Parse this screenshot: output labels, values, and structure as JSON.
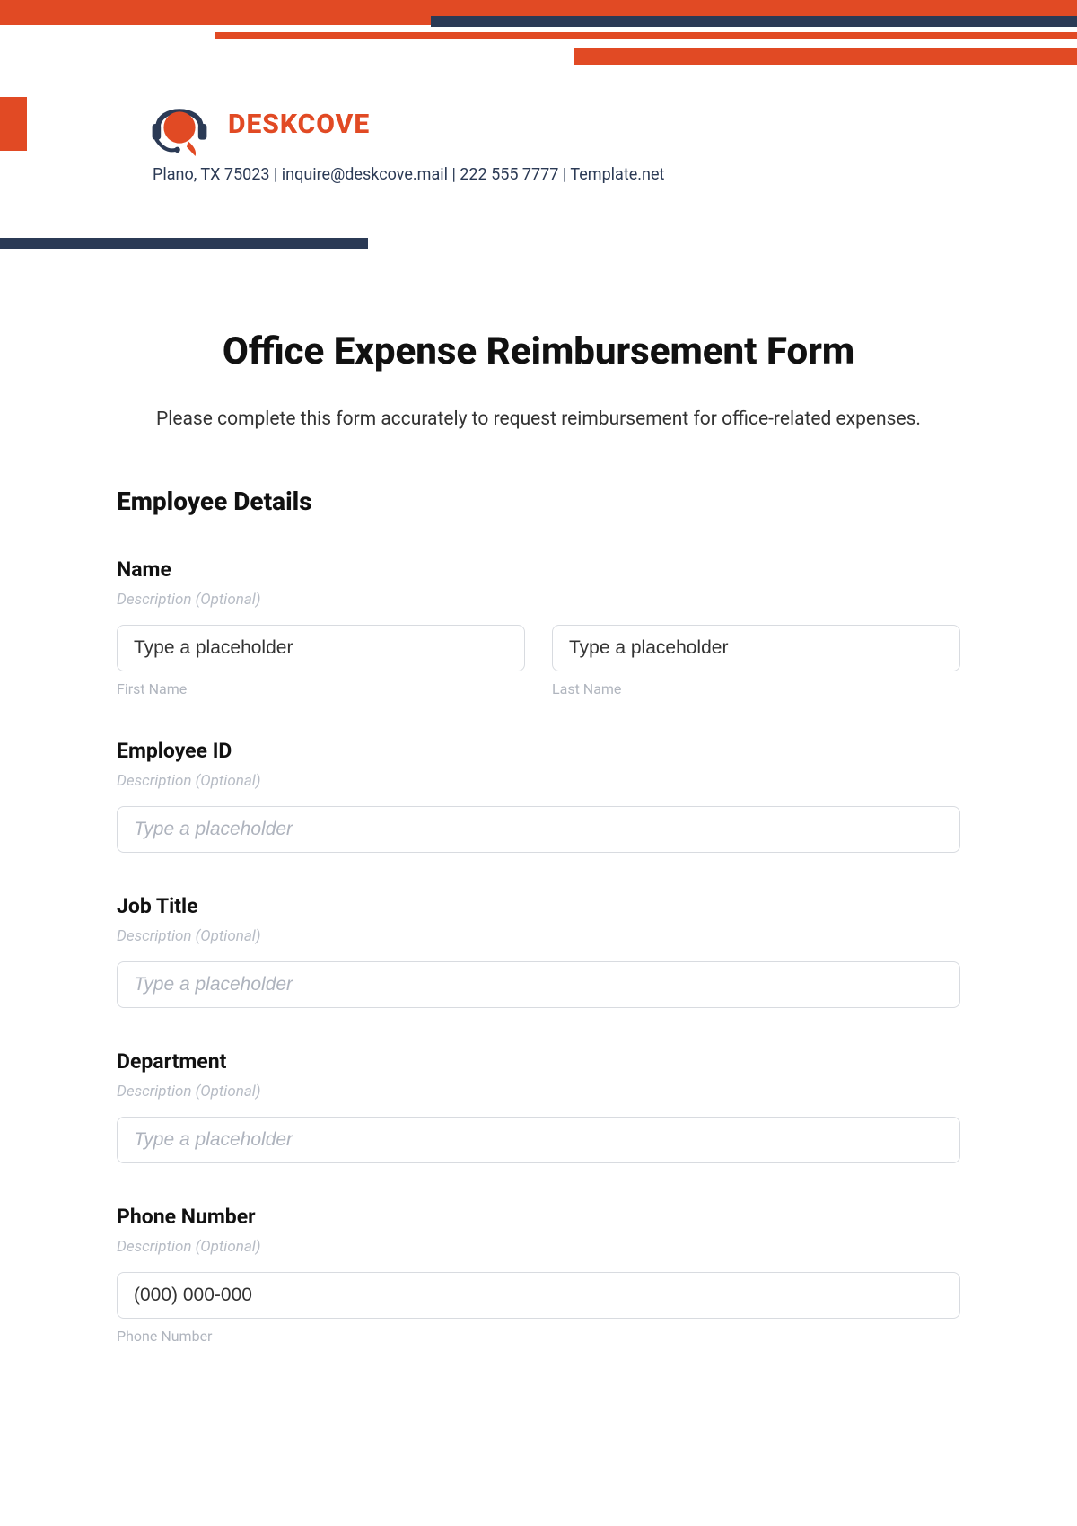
{
  "brand": {
    "name": "DESKCOVE",
    "contact": "Plano, TX 75023 | inquire@deskcove.mail | 222 555 7777 | Template.net"
  },
  "form": {
    "title": "Office Expense Reimbursement Form",
    "subtitle": "Please complete this form accurately to request reimbursement for office-related expenses.",
    "section_employee": "Employee Details",
    "desc_optional": "Description (Optional)",
    "placeholder_typed": "Type a placeholder",
    "name": {
      "label": "Name",
      "first_sub": "First Name",
      "last_sub": "Last Name"
    },
    "employee_id": {
      "label": "Employee ID"
    },
    "job_title": {
      "label": "Job Title"
    },
    "department": {
      "label": "Department"
    },
    "phone": {
      "label": "Phone Number",
      "placeholder": "(000) 000-000",
      "sub": "Phone Number"
    }
  }
}
